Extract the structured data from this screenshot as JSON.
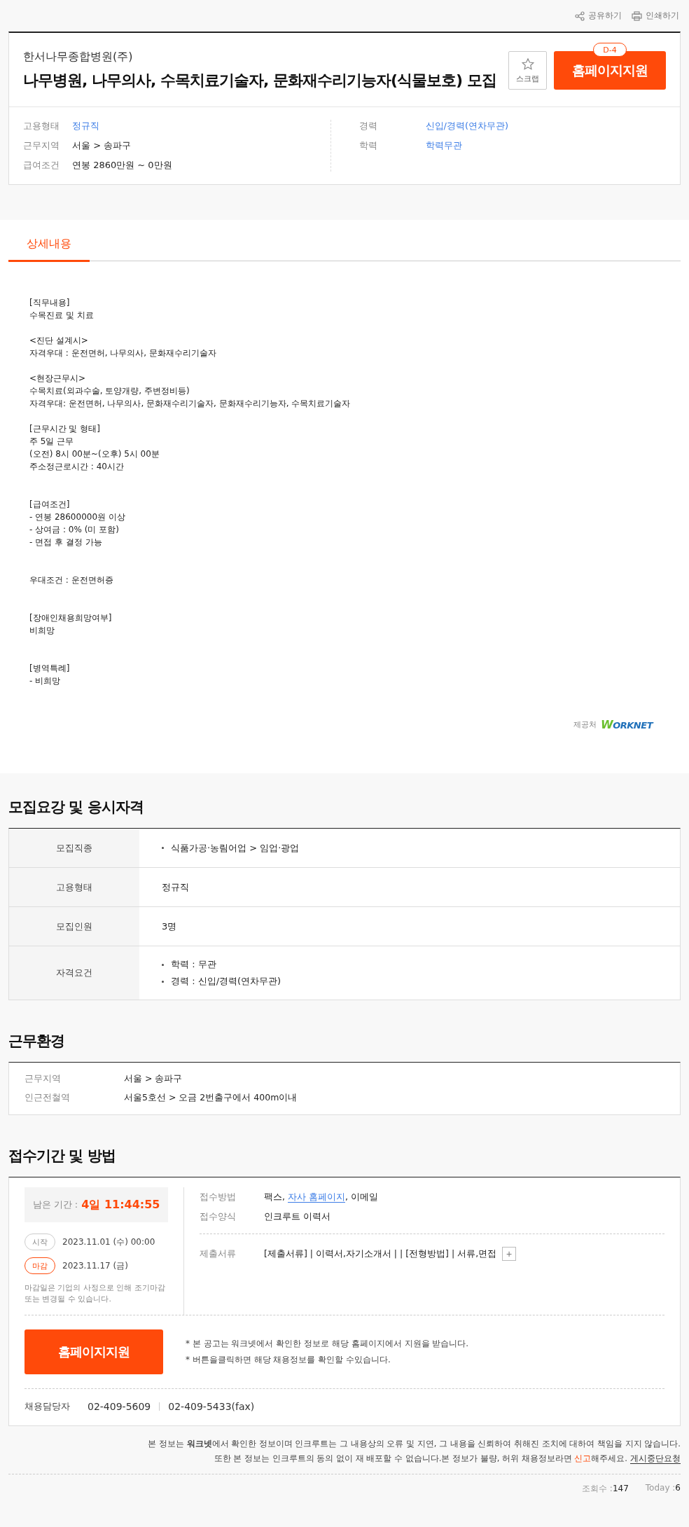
{
  "toolbar": [
    {
      "kind": "share",
      "label": "공유하기"
    },
    {
      "kind": "print",
      "label": "인쇄하기"
    }
  ],
  "header": {
    "company": "한서나무종합병원(주)",
    "title": "나무병원, 나무의사, 수목치료기술자, 문화재수리기능자(식물보호) 모집",
    "scrap": "스크랩",
    "apply": "홈페이지지원",
    "dday": "D-4"
  },
  "summary": {
    "left": [
      {
        "label": "고용형태",
        "value": "정규직",
        "link": true
      },
      {
        "label": "근무지역",
        "value": "서울 > 송파구",
        "link": false
      },
      {
        "label": "급여조건",
        "value": "연봉 2860만원 ~ 0만원",
        "link": false
      }
    ],
    "right": [
      {
        "label": "경력",
        "value": "신입/경력(연차무관)",
        "link": true
      },
      {
        "label": "학력",
        "value": "학력무관",
        "link": true
      }
    ]
  },
  "tabs": [
    {
      "label": "상세내용",
      "selected": true
    }
  ],
  "detail": [
    {
      "paragraphs": [
        {
          "lines": [
            "[직무내용]",
            "수목진료 및 치료"
          ]
        },
        {
          "lines": [
            "<진단 설계시>",
            "자격우대 : 운전면허, 나무의사, 문화재수리기술자"
          ]
        },
        {
          "lines": [
            "<현장근무시>",
            "수목치료(외과수술, 토양개량, 주변정비등)",
            "자격우대: 운전면허, 나무의사, 문화재수리기술자, 문화재수리기능자, 수목치료기술자"
          ]
        },
        {
          "lines": [
            "[근무시간 및 형태]",
            "주 5일 근무",
            "(오전) 8시 00분~(오후) 5시 00분",
            "주소정근로시간 : 40시간"
          ]
        }
      ]
    },
    {
      "paragraphs": [
        {
          "lines": [
            "[급여조건]",
            "- 연봉 28600000원 이상",
            "- 상여금 : 0% (미 포함)",
            "- 면접 후 결정 가능"
          ]
        }
      ]
    },
    {
      "paragraphs": [
        {
          "lines": [
            "우대조건 : 운전면허증"
          ]
        }
      ]
    },
    {
      "paragraphs": [
        {
          "lines": [
            "[장애인채용희망여부]",
            "비희망"
          ]
        }
      ]
    },
    {
      "paragraphs": [
        {
          "lines": [
            "[병역특례]",
            "- 비희망"
          ]
        }
      ]
    }
  ],
  "provider": {
    "label": "제공처",
    "logo_w": "W",
    "logo_rest": "ORKNET"
  },
  "requirements": {
    "title": "모집요강 및 응시자격",
    "rows": [
      {
        "label": "모집직종",
        "items": [
          "식품가공·농림어업 > 임업·광업"
        ],
        "bullets": true
      },
      {
        "label": "고용형태",
        "items": [
          "정규직"
        ],
        "bullets": false
      },
      {
        "label": "모집인원",
        "items": [
          "3명"
        ],
        "bullets": false
      },
      {
        "label": "자격요건",
        "items": [
          "학력 : 무관",
          "경력 : 신입/경력(연차무관)"
        ],
        "bullets": true
      }
    ]
  },
  "environment": {
    "title": "근무환경",
    "rows": [
      {
        "label": "근무지역",
        "value": "서울 > 송파구"
      },
      {
        "label": "인근전철역",
        "value": "서울5호선 > 오금 2번출구에서 400m이내"
      }
    ]
  },
  "reception": {
    "title": "접수기간 및 방법",
    "remaining_label": "남은 기간 :",
    "remaining": "4일 11:44:55",
    "dates": [
      {
        "kind": "start",
        "tag": "시작",
        "date": "2023.11.01 (수) 00:00"
      },
      {
        "kind": "end",
        "tag": "마감",
        "date": "2023.11.17 (금)"
      }
    ],
    "date_note": "마감일은 기업의 사정으로 인해 조기마감 또는 변경될 수 있습니다.",
    "method_label": "접수방법",
    "method": [
      {
        "kind": "text",
        "text": "팩스, "
      },
      {
        "kind": "link",
        "text": "자사 홈페이지"
      },
      {
        "kind": "text",
        "text": ", 이메일"
      }
    ],
    "form_label": "접수양식",
    "form": "인크루트 이력서",
    "docs_label": "제출서류",
    "docs": "[제출서류] | 이력서,자기소개서 | | [전형방법] | 서류,면접",
    "docs_more": "+",
    "apply": "홈페이지지원",
    "notes": [
      "* 본 공고는 워크넷에서 확인한 정보로 해당 홈페이지에서 지원을 받습니다.",
      "* 버튼을클릭하면 해당 채용정보를 확인할 수있습니다."
    ],
    "contact_label": "채용담당자",
    "phones": [
      "02-409-5609",
      "02-409-5433(fax)"
    ]
  },
  "footer": {
    "line1": "본 정보는 **워크넷**에서 확인한 정보이며 인크루트는 그 내용상의 오류 및 지연, 그 내용을 신뢰하여 취해진 조치에 대하여 책임을 지지 않습니다.",
    "line2_before": "또한 본 정보는 인크루트의 동의 없이 재 배포할 수 없습니다.본 정보가 불량, 허위 채용정보라면 ",
    "report": "신고",
    "line2_after": "해주세요.",
    "stop": "게시중단요청"
  },
  "stats": [
    {
      "label": "조회수 :",
      "value": "147"
    },
    {
      "label": "Today :",
      "value": "6"
    }
  ]
}
